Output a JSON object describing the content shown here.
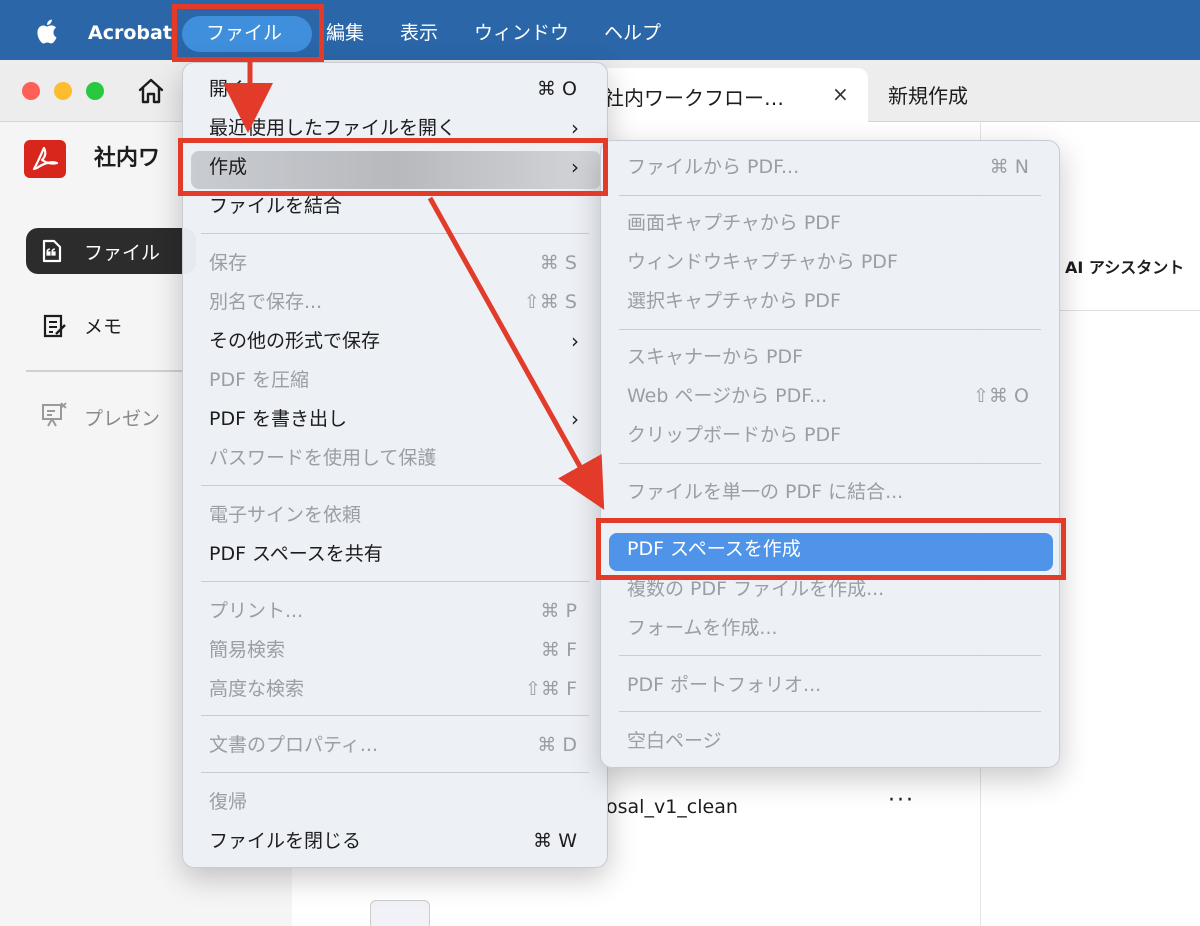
{
  "menubar": {
    "app_name": "Acrobat",
    "items": [
      "ファイル",
      "編集",
      "表示",
      "ウィンドウ",
      "ヘルプ"
    ]
  },
  "tabs": {
    "active_label": "社内ワークフロー…",
    "close_symbol": "×",
    "new_tab_label": "新規作成"
  },
  "sidebar": {
    "doc_title": "社内ワ",
    "items": [
      {
        "label": "ファイル",
        "icon": "file-icon",
        "selected": true
      },
      {
        "label": "メモ",
        "icon": "memo-icon",
        "selected": false
      },
      {
        "label": "プレゼン",
        "icon": "presentation-icon",
        "selected": false
      }
    ]
  },
  "right_panel": {
    "ai_assistant": "AI アシスタント"
  },
  "file_list": {
    "file_name": "osal_v1_clean",
    "more": "···"
  },
  "file_menu": {
    "items": [
      {
        "label": "開く...",
        "shortcut": "⌘ O",
        "enabled": true
      },
      {
        "label": "最近使用したファイルを開く",
        "submenu": true,
        "enabled": true
      },
      {
        "label": "作成",
        "submenu": true,
        "enabled": true,
        "highlighted": true
      },
      {
        "label": "ファイルを結合",
        "enabled": true
      },
      {
        "label": "保存",
        "shortcut": "⌘ S",
        "enabled": false
      },
      {
        "label": "別名で保存...",
        "shortcut": "⇧⌘ S",
        "enabled": false
      },
      {
        "label": "その他の形式で保存",
        "submenu": true,
        "enabled": true
      },
      {
        "label": "PDF を圧縮",
        "enabled": false
      },
      {
        "label": "PDF を書き出し",
        "submenu": true,
        "enabled": true
      },
      {
        "label": "パスワードを使用して保護",
        "enabled": false
      },
      {
        "label": "電子サインを依頼",
        "enabled": false
      },
      {
        "label": "PDF スペースを共有",
        "enabled": true
      },
      {
        "label": "プリント...",
        "shortcut": "⌘ P",
        "enabled": false
      },
      {
        "label": "簡易検索",
        "shortcut": "⌘ F",
        "enabled": false
      },
      {
        "label": "高度な検索",
        "shortcut": "⇧⌘ F",
        "enabled": false
      },
      {
        "label": "文書のプロパティ...",
        "shortcut": "⌘ D",
        "enabled": false
      },
      {
        "label": "復帰",
        "enabled": false
      },
      {
        "label": "ファイルを閉じる",
        "shortcut": "⌘ W",
        "enabled": true
      }
    ],
    "chevron": "›"
  },
  "create_submenu": {
    "items": [
      {
        "label": "ファイルから PDF...",
        "shortcut": "⌘ N"
      },
      {
        "label": "画面キャプチャから PDF"
      },
      {
        "label": "ウィンドウキャプチャから PDF"
      },
      {
        "label": "選択キャプチャから PDF"
      },
      {
        "label": "スキャナーから PDF"
      },
      {
        "label": "Web ページから PDF...",
        "shortcut": "⇧⌘ O"
      },
      {
        "label": "クリップボードから PDF"
      },
      {
        "label": "ファイルを単一の PDF に結合..."
      },
      {
        "label": "PDF スペースを作成",
        "highlighted": true
      },
      {
        "label": "複数の PDF ファイルを作成..."
      },
      {
        "label": "フォームを作成..."
      },
      {
        "label": "PDF ポートフォリオ..."
      },
      {
        "label": "空白ページ"
      }
    ]
  },
  "colors": {
    "menubar": "#2a66a8",
    "annotation": "#e23b2a",
    "highlight": "#4f94e8",
    "acrobat_red": "#d9261c"
  }
}
